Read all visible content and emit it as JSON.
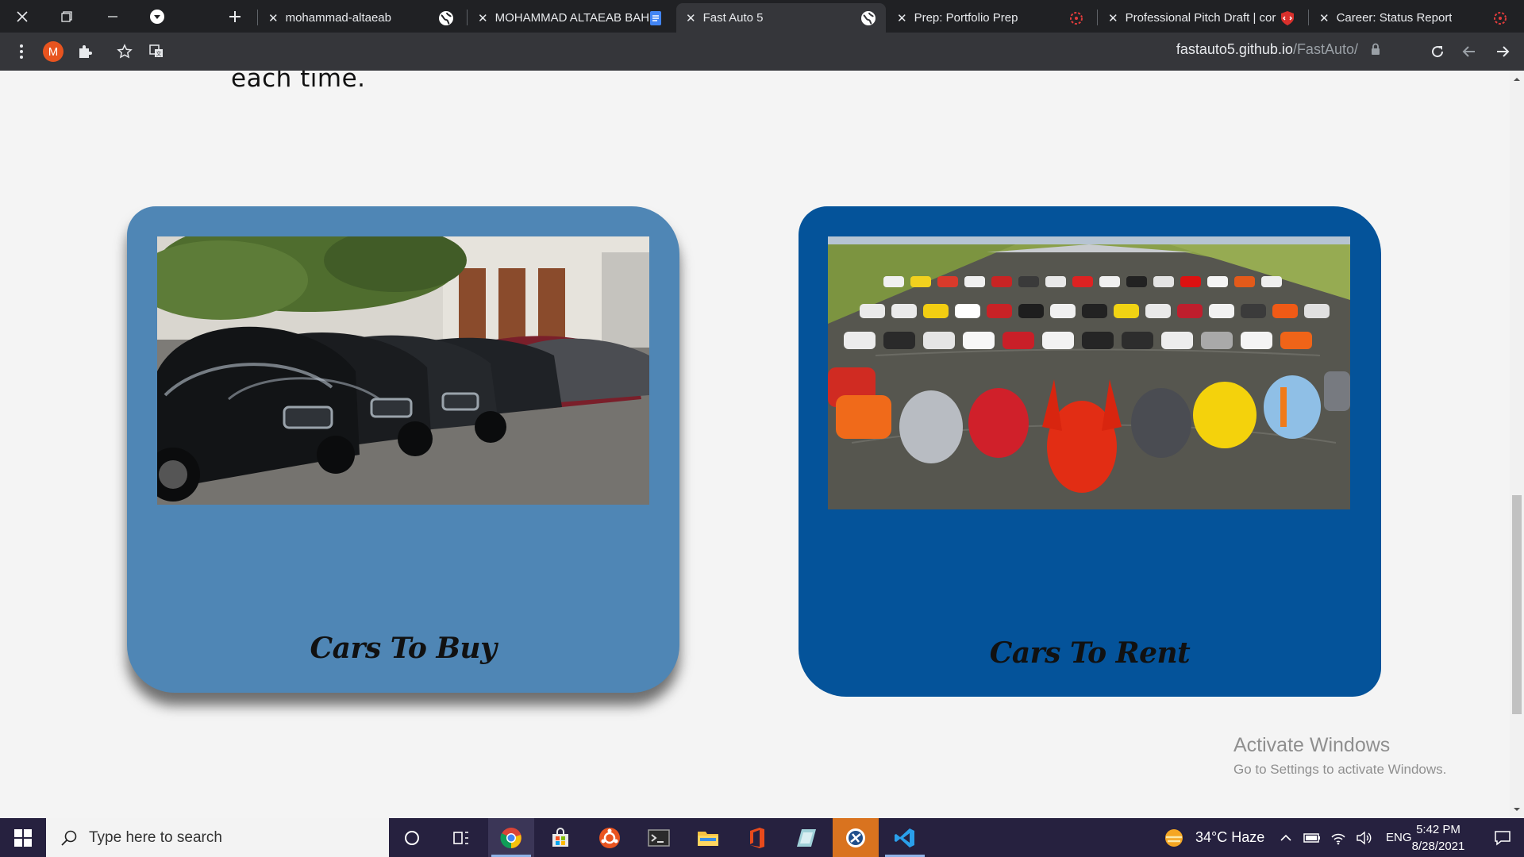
{
  "browser": {
    "tabs": [
      {
        "label": "mohammad-altaeab",
        "active": false
      },
      {
        "label": "MOHAMMAD ALTAEAB BAH",
        "active": false
      },
      {
        "label": "Fast Auto 5",
        "active": true
      },
      {
        "label": "Prep: Portfolio Prep",
        "active": false
      },
      {
        "label": "Professional Pitch Draft | cor",
        "active": false
      },
      {
        "label": "Career: Status Report",
        "active": false
      }
    ],
    "profile_initial": "M",
    "url_host": "fastauto5.github.io",
    "url_path": "/FastAuto/"
  },
  "page": {
    "intro_tail": "each time.",
    "cards": [
      {
        "title": "Cars To Buy",
        "image": "dealership-cars-photo",
        "color": "#4f86b5"
      },
      {
        "title": "Cars To Rent",
        "image": "supercars-runway-photo",
        "color": "#04539a"
      }
    ]
  },
  "watermark": {
    "title": "Activate Windows",
    "subtitle": "Go to Settings to activate Windows."
  },
  "taskbar": {
    "search_placeholder": "Type here to search",
    "weather": "34°C  Haze",
    "language": "ENG",
    "time": "5:42 PM",
    "date": "8/28/2021",
    "apps": [
      "cortana-icon",
      "task-view-icon",
      "chrome-icon",
      "store-icon",
      "ubuntu-icon",
      "terminal-icon",
      "file-explorer-icon",
      "office-icon",
      "notes-icon",
      "snipping-icon",
      "vscode-icon"
    ]
  }
}
